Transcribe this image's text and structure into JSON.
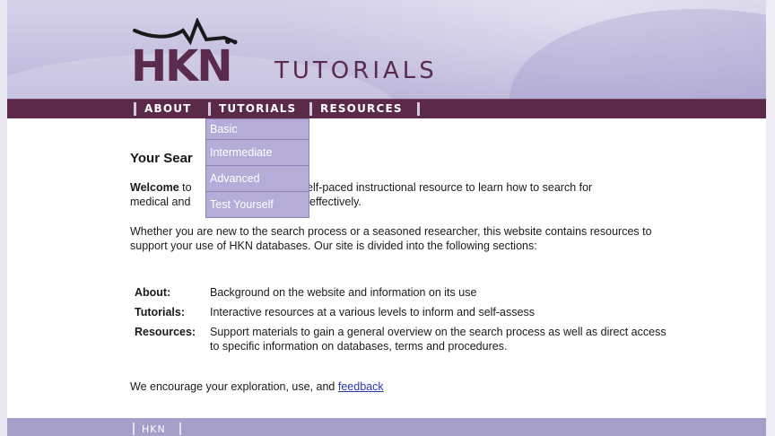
{
  "header": {
    "logo_text": "HKN",
    "site_title": "TUTORIALS"
  },
  "nav": {
    "items": [
      {
        "label": "ABOUT"
      },
      {
        "label": "TUTORIALS"
      },
      {
        "label": "RESOURCES"
      }
    ]
  },
  "dropdown": {
    "items": [
      {
        "label": "Basic"
      },
      {
        "label": "Intermediate"
      },
      {
        "label": "Advanced"
      },
      {
        "label": "Test Yourself"
      }
    ]
  },
  "main": {
    "title_visible": "Your Sear",
    "p1_bold": "Welcome",
    "p1_line1_a": " to",
    "p1_line1_b": "elf-paced instructional resource to learn how to search for",
    "p1_line2_a": "medical and",
    "p1_line2_b": "effectively.",
    "p2": "Whether you are new to the search process or a seasoned researcher, this website contains resources to support your use of HKN databases. Our site is divided into the following sections:",
    "definitions": [
      {
        "term": "About:",
        "desc": "Background on the website and information on its use"
      },
      {
        "term": "Tutorials:",
        "desc": "Interactive resources at a various levels to inform and self-assess"
      },
      {
        "term": "Resources:",
        "desc": "Support materials to gain a general overview on the search process as well as direct access to specific information on databases, terms and procedures."
      }
    ],
    "p3_text": "We encourage your exploration, use, and ",
    "p3_link": "feedback"
  },
  "footer": {
    "items": [
      {
        "label": "HKN"
      }
    ]
  },
  "colors": {
    "nav_bg": "#5b2a49",
    "brand": "#5a2b4c",
    "dropdown_bg": "#b6acd8",
    "link": "#2b3bb0"
  }
}
